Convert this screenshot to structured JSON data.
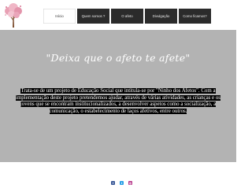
{
  "nav": {
    "items": [
      {
        "label": "Início",
        "active": true
      },
      {
        "label": "Quem somos ?",
        "active": false
      },
      {
        "label": "O afeto",
        "active": false
      },
      {
        "label": "Divulgação",
        "active": false
      },
      {
        "label": "Como ficamos?",
        "active": false
      }
    ]
  },
  "hero": {
    "slogan": "\"Deixa que o afeto te afete\"",
    "description": "Trata-se de um projeto de Educação Social que intitula-se por  \"Ninho dos Afetos\". Com a implementação deste projeto pretendemos ajudar, através de várias atividades, as crianças e os jovens que se encontram institucionalizados, a desenvolver aspetos como a socialização, a comunicação, o estabelecimento de laços afetivos,  entre outros."
  },
  "footer": {
    "social": [
      {
        "icon": "facebook-icon",
        "glyph": "f",
        "color": "#3b5998"
      },
      {
        "icon": "twitter-icon",
        "glyph": "t",
        "color": "#2aa0e6"
      },
      {
        "icon": "instagram-icon",
        "glyph": "◎",
        "color": "#b6378a"
      }
    ]
  },
  "colors": {
    "nav_background": "#2b2b2b",
    "hero_background": "#b3b3b3",
    "text_highlight": "#000000"
  }
}
